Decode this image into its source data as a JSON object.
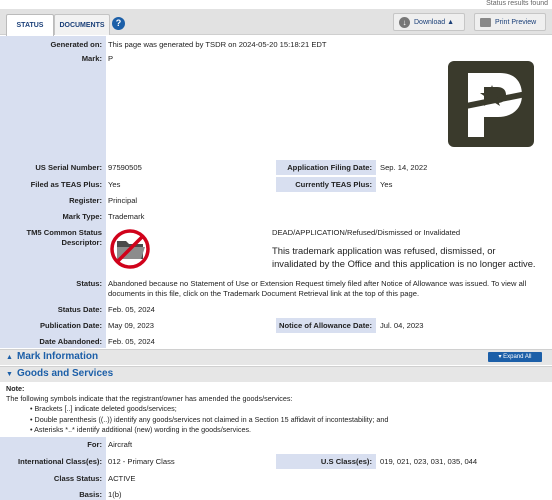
{
  "status_results": "Status results found",
  "tabs": {
    "status": "STATUS",
    "documents": "DOCUMENTS",
    "help": "?"
  },
  "toolbar": {
    "download": "Download ▲",
    "print": "Print Preview"
  },
  "fields": {
    "generated_on_label": "Generated on:",
    "generated_on": "This page was generated by TSDR on 2024-05-20 15:18:21 EDT",
    "mark_label": "Mark:",
    "mark": "P",
    "serial_label": "US Serial Number:",
    "serial": "97590505",
    "filing_date_label": "Application Filing Date:",
    "filing_date": "Sep. 14, 2022",
    "teas_label": "Filed as TEAS Plus:",
    "teas": "Yes",
    "current_teas_label": "Currently TEAS Plus:",
    "current_teas": "Yes",
    "register_label": "Register:",
    "register": "Principal",
    "mark_type_label": "Mark Type:",
    "mark_type": "Trademark",
    "tm5_label_1": "TM5 Common Status",
    "tm5_label_2": "Descriptor:",
    "tm5_status": "DEAD/APPLICATION/Refused/Dismissed or Invalidated",
    "tm5_desc": "This trademark application was refused, dismissed, or invalidated by the Office and this application is no longer active.",
    "status_label": "Status:",
    "status": "Abandoned because no Statement of Use or Extension Request timely filed after Notice of Allowance was issued. To view all documents in this file, click on the Trademark Document Retrieval link at the top of this page.",
    "status_date_label": "Status Date:",
    "status_date": "Feb. 05, 2024",
    "pub_date_label": "Publication Date:",
    "pub_date": "May 09, 2023",
    "noa_label": "Notice of Allowance Date:",
    "noa": "Jul. 04, 2023",
    "abandoned_label": "Date Abandoned:",
    "abandoned": "Feb. 05, 2024"
  },
  "sections": {
    "mark_info": "Mark Information",
    "expand_all": "▾ Expand All",
    "goods": "Goods and Services"
  },
  "goods": {
    "note_title": "Note:",
    "note_text": "The following symbols indicate that the registrant/owner has amended the goods/services:",
    "bullets": [
      "• Brackets [..] indicate deleted goods/services;",
      "• Double parenthesis ((..)) identify any goods/services not claimed in a Section 15 affidavit of incontestability; and",
      "• Asterisks *..* identify additional (new) wording in the goods/services."
    ],
    "for_label": "For:",
    "for": "Aircraft",
    "intl_label": "International Class(es):",
    "intl": "012 - Primary Class",
    "us_label": "U.S Class(es):",
    "us": "019, 021, 023, 031, 035, 044",
    "class_status_label": "Class Status:",
    "class_status": "ACTIVE",
    "basis_label": "Basis:",
    "basis": "1(b)"
  },
  "colors": {
    "accent": "#1c5fa8",
    "label_bg": "#d8dff0",
    "logo_bg": "#3a3a2c",
    "dead_red": "#d0021b"
  }
}
